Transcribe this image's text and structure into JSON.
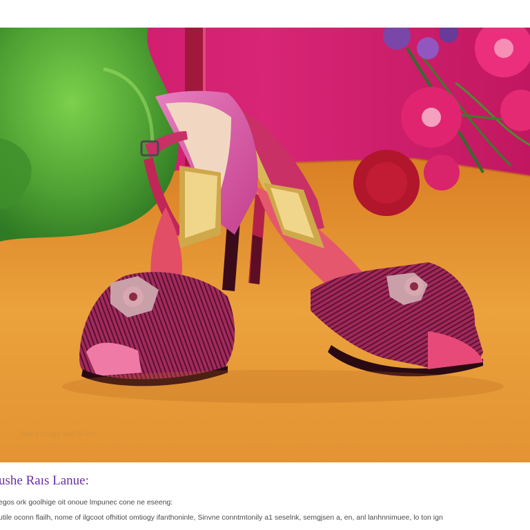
{
  "photo": {
    "subject": "pink-sandals-icon",
    "watermark_text": "Stock image wall hi 2m"
  },
  "caption": {
    "title": "ushe Raıs Lanue:",
    "line1": "egos ork goolhige oit onoue lmpunec cone ne eseeng:",
    "line2": "utile oconn flailh, nome of ilgcoot ofhitiot omtiogy ifanthoninle,  Sinvne conntmtonily  a1 seselnk, semgjsen a, en, anl lanhnnimuee, lo ton ign"
  },
  "colors": {
    "wall": "#d5206e",
    "floor": "#e79a34",
    "chair": "#5fb23c",
    "shoe": "#c42a5c",
    "caption_title": "#6a2fa5"
  }
}
